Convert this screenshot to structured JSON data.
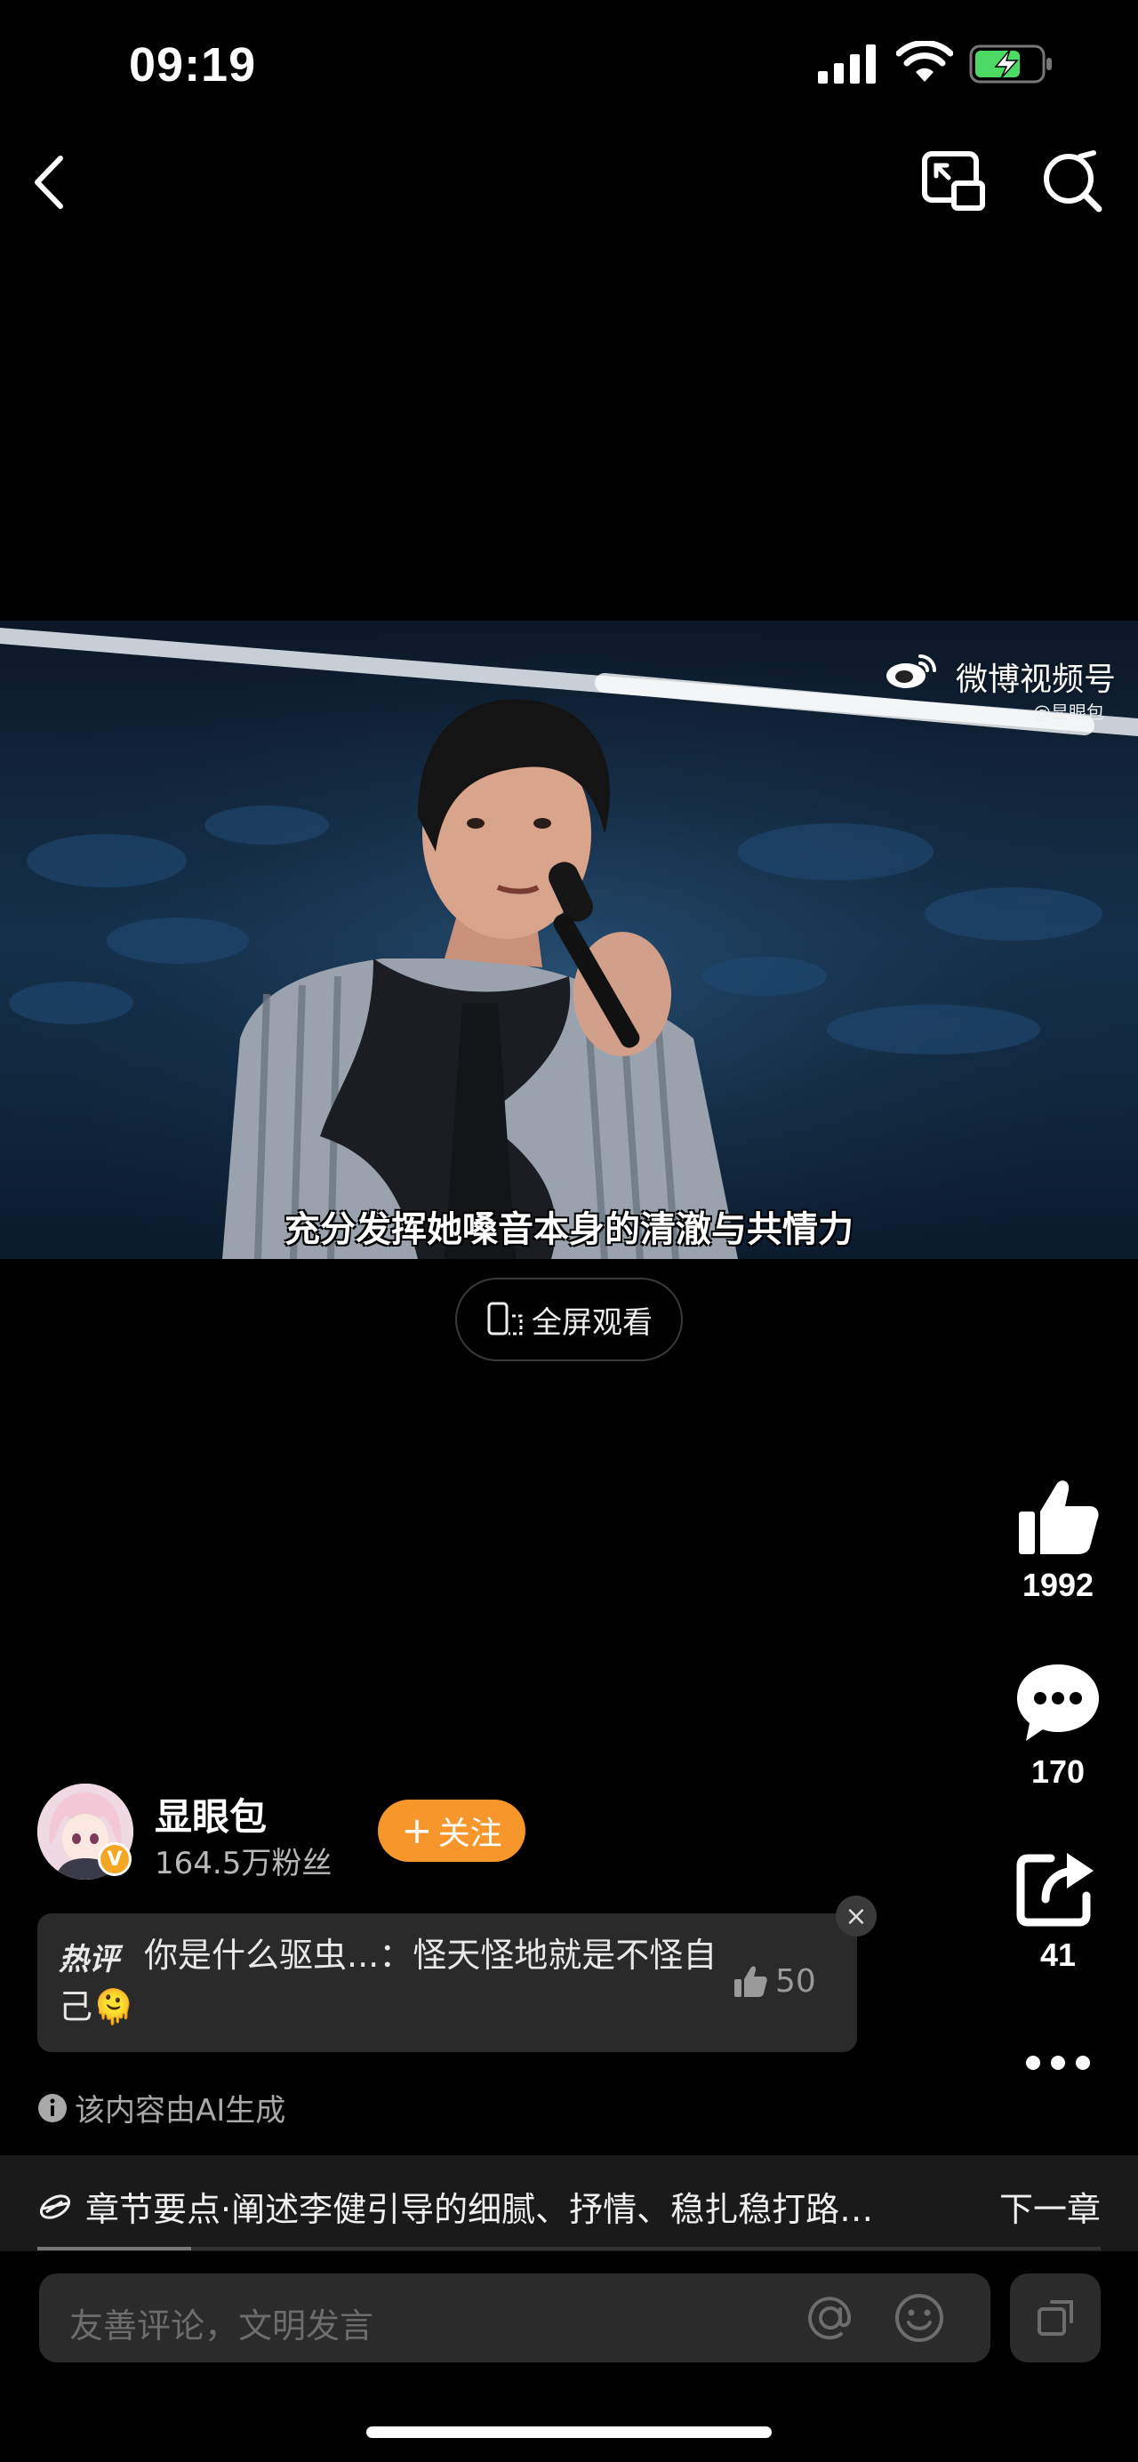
{
  "status_bar": {
    "time": "09:19"
  },
  "nav": {
    "back_icon": "chevron-left-icon",
    "pip_icon": "picture-in-picture-icon",
    "search_icon": "search-icon"
  },
  "video": {
    "watermark_title": "微博视频号",
    "watermark_sub": "@显眼包",
    "subtitle": "充分发挥她嗓音本身的清澈与共情力"
  },
  "fullscreen_label": "全屏观看",
  "rail": {
    "likes": "1992",
    "comments": "170",
    "shares": "41"
  },
  "author": {
    "name": "显眼包",
    "fans": "164.5万粉丝",
    "follow_label": "关注"
  },
  "hot_comment": {
    "tag": "热评",
    "text": "你是什么驱虫...：怪天怪地就是不怪自己🫠",
    "likes": "50"
  },
  "ai_note": "该内容由AI生成",
  "chapter": {
    "text": "章节要点·阐述李健引导的细腻、抒情、稳扎稳打路…",
    "next": "下一章",
    "progress": 0.145
  },
  "input": {
    "placeholder": "友善评论，文明发言"
  },
  "colors": {
    "accent": "#f7962b",
    "background": "#000000",
    "card": "#2a2a2a"
  }
}
